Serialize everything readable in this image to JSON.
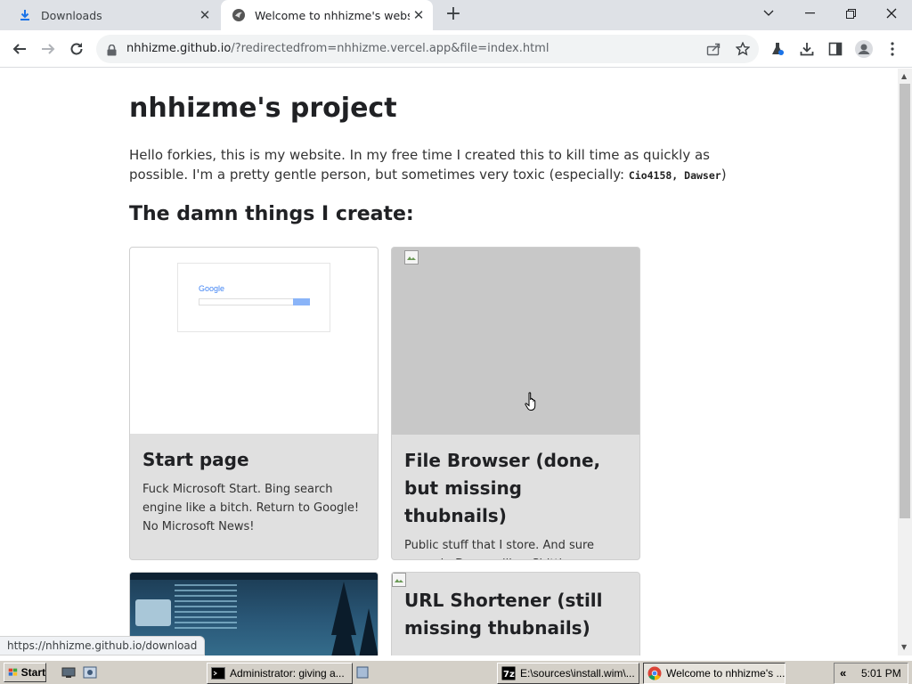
{
  "browser": {
    "tabs": [
      {
        "title": "Downloads",
        "icon": "download-icon"
      },
      {
        "title": "Welcome to nhhizme's website!",
        "icon": "site-favicon-icon"
      }
    ],
    "address": {
      "host": "nhhizme.github.io",
      "path": "/?redirectedfrom=nhhizme.vercel.app&file=index.html"
    },
    "status_url": "https://nhhizme.github.io/download"
  },
  "page": {
    "heading": "nhhizme's project",
    "intro_text": "Hello forkies, this is my website. In my free time I created this to kill time as quickly as possible. I'm a pretty gentle person, but sometimes very toxic (especially: ",
    "intro_code": "Cio4158, Dawser",
    "intro_close": ")",
    "section_heading": "The damn things I create:",
    "thumb_start_page_brand": "Google",
    "cards": [
      {
        "title": "Start page",
        "description": "Fuck Microsoft Start. Bing search engine like a bitch. Return to Google! No Microsoft News!"
      },
      {
        "title": "File Browser (done, but missing thubnails)",
        "description": "Public stuff that I store. And sure enough, Dawser likes Shittium browser."
      },
      {
        "title": "",
        "description": ""
      },
      {
        "title": "URL Shortener (still missing thubnails)",
        "description": ""
      }
    ]
  },
  "taskbar": {
    "start_label": "Start",
    "buttons": [
      {
        "label": "Administrator:  giving a...",
        "icon": "cmd-icon"
      },
      {
        "label": "E:\\sources\\install.wim\\...",
        "icon": "7zip-icon"
      },
      {
        "label": "Welcome to nhhizme's ...",
        "icon": "chrome-icon"
      }
    ],
    "clock": "5:01 PM",
    "tray_arrow": "«"
  }
}
